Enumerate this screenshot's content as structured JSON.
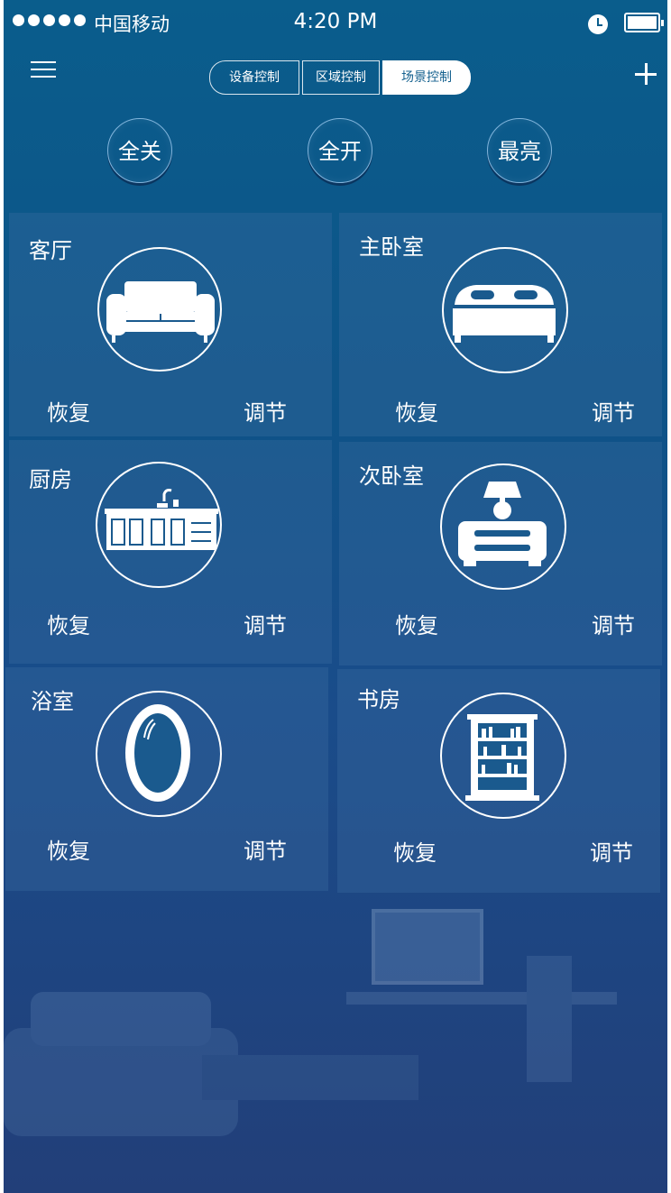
{
  "status_bar": {
    "carrier": "中国移动",
    "time": "4:20 PM"
  },
  "tabs": [
    "设备控制",
    "区域控制",
    "场景控制"
  ],
  "active_tab": "场景控制",
  "quick_actions": [
    "全关",
    "全开",
    "最亮"
  ],
  "rooms": [
    {
      "name": "客厅",
      "icon": "sofa-icon",
      "restore": "恢复",
      "adjust": "调节"
    },
    {
      "name": "主卧室",
      "icon": "bed-icon",
      "restore": "恢复",
      "adjust": "调节"
    },
    {
      "name": "厨房",
      "icon": "kitchen-cabinet-icon",
      "restore": "恢复",
      "adjust": "调节"
    },
    {
      "name": "次卧室",
      "icon": "nightstand-lamp-icon",
      "restore": "恢复",
      "adjust": "调节"
    },
    {
      "name": "浴室",
      "icon": "mirror-icon",
      "restore": "恢复",
      "adjust": "调节"
    },
    {
      "name": "书房",
      "icon": "bookshelf-icon",
      "restore": "恢复",
      "adjust": "调节"
    }
  ]
}
